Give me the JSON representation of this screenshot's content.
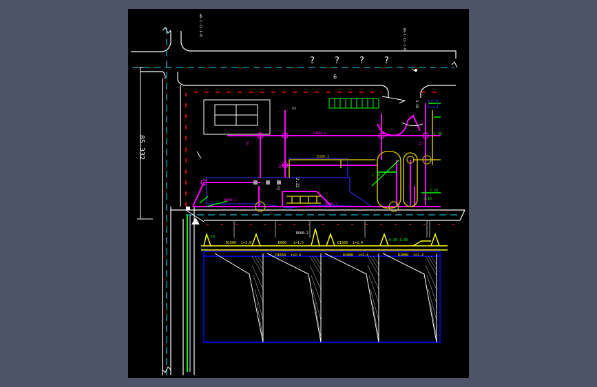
{
  "viewer": {
    "background": "#4e5468",
    "canvas_color": "#000000"
  },
  "drawing": {
    "dimension_left": "85.332",
    "road_marks": [
      "?",
      "?",
      "?",
      "?"
    ],
    "road_label": "6",
    "top_left_rotated_text": "a6-1-11-1-0",
    "top_right_rotated_text": "a6-1-11-1-0",
    "pipe_labels": {
      "d400_3": "D400-3",
      "d300_3": "D300-3",
      "d400_1": "D400-1",
      "d400_2": "D400-2",
      "d600_2": "D600-2",
      "d1500": "D1500",
      "d600": "D600",
      "d1500_b": "D1500",
      "d2000_a": "D1650",
      "d2000_b": "D2000",
      "d2000_c": "D2000"
    },
    "slope_labels": {
      "s1": "i=1.0",
      "s2": "i=1.5",
      "s3": "i=2.0",
      "s4": "i=2.4",
      "s5": "i=2.4",
      "s6": "i=2.4"
    },
    "small_labels": {
      "y1": "Y7",
      "y2": "Y5",
      "y3": "Y3",
      "y4": "Y2",
      "y5": "Y1",
      "n1": "3.16",
      "n2": "2.32",
      "n3": "1.16",
      "n4": "2.16",
      "n5": "-0.30",
      "n6": "1.30",
      "n7": "2.16",
      "n8": "1.46",
      "n9": "-2.16"
    },
    "colors": {
      "white": "#ffffff",
      "magenta": "#ff00ff",
      "yellow": "#ffff00",
      "olive": "#c8b400",
      "green": "#00ff00",
      "cyan": "#00ffff",
      "blue": "#0000ff",
      "red": "#ff0000",
      "navy": "#2020c0"
    }
  }
}
